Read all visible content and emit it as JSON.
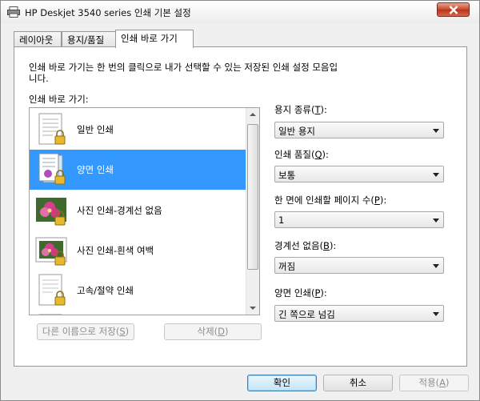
{
  "window": {
    "title": "HP Deskjet 3540 series 인쇄 기본 설정"
  },
  "tabs": [
    {
      "label": "레이아웃"
    },
    {
      "label": "용지/품질"
    },
    {
      "label": "인쇄 바로 가기"
    }
  ],
  "panel": {
    "description": "인쇄 바로 가기는 한 번의 클릭으로 내가 선택할 수 있는 저장된 인쇄 설정 모음입니다.",
    "list_label": "인쇄 바로 가기:",
    "shortcuts": [
      {
        "label": "일반 인쇄"
      },
      {
        "label": "양면 인쇄"
      },
      {
        "label": "사진 인쇄-경계선 없음"
      },
      {
        "label": "사진 인쇄-흰색 여백"
      },
      {
        "label": "고속/절약 인쇄"
      }
    ],
    "save_as_button": {
      "text": "다른 이름으로 저장(",
      "key": "S",
      "tail": ")"
    },
    "delete_button": {
      "text": "삭제(",
      "key": "D",
      "tail": ")"
    }
  },
  "settings": {
    "paper_type": {
      "label": "용지 종류(",
      "key": "T",
      "tail": "):",
      "value": "일반 용지"
    },
    "print_quality": {
      "label": "인쇄 품질(",
      "key": "Q",
      "tail": "):",
      "value": "보통"
    },
    "pages_per_sheet": {
      "label": "한 면에 인쇄할 페이지 수(",
      "key": "P",
      "tail": "):",
      "value": "1"
    },
    "borderless": {
      "label": "경계선 없음(",
      "key": "B",
      "tail": "):",
      "value": "꺼짐"
    },
    "duplex": {
      "label": "양면 인쇄(",
      "key": "P",
      "tail": "):",
      "value": "긴 쪽으로 넘김"
    }
  },
  "footer": {
    "ok": "확인",
    "cancel": "취소",
    "apply": {
      "text": "적용(",
      "key": "A",
      "tail": ")"
    }
  },
  "colors": {
    "selection": "#3399ff",
    "close_button": "#c7462a"
  },
  "icons": {
    "title": "printer-icon",
    "close": "close-icon",
    "lock": "lock-icon"
  }
}
